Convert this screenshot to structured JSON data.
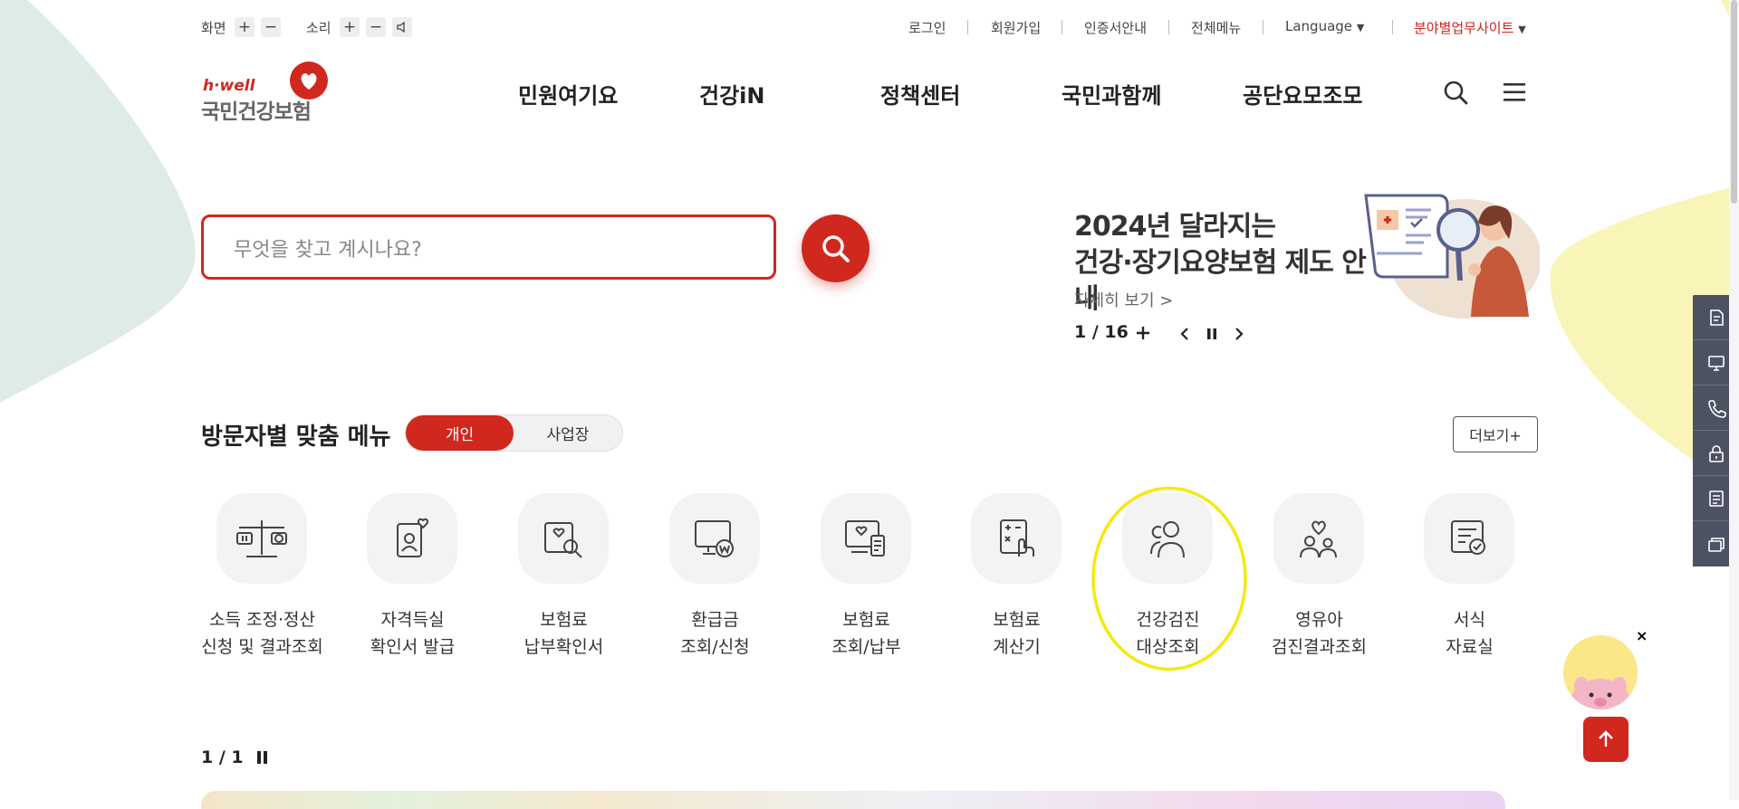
{
  "util": {
    "screen_label": "화면",
    "sound_label": "소리",
    "plus": "+",
    "minus": "−",
    "links": [
      "로그인",
      "회원가입",
      "인증서안내",
      "전체메뉴",
      "Language",
      "분야별업무사이트"
    ]
  },
  "logo": {
    "tagline": "h·well",
    "name": "국민건강보험"
  },
  "nav": [
    "민원여기요",
    "건강iN",
    "정책센터",
    "국민과함께",
    "공단요모조모"
  ],
  "search": {
    "placeholder": "무엇을 찾고 계시나요?"
  },
  "banner": {
    "title_line1": "2024년 달라지는",
    "title_line2": "건강·장기요양보험 제도 안내",
    "more": "자세히 보기 >",
    "page_current": "1",
    "page_total": "16"
  },
  "personal_menu": {
    "title": "방문자별 맞춤 메뉴",
    "tabs": [
      "개인",
      "사업장"
    ],
    "more": "더보기+",
    "items": [
      {
        "line1": "소득 조정·정산",
        "line2": "신청 및 결과조회",
        "icon": "scale-icon"
      },
      {
        "line1": "자격득실",
        "line2": "확인서 발급",
        "icon": "id-card-heart-icon"
      },
      {
        "line1": "보험료",
        "line2": "납부확인서",
        "icon": "document-search-icon"
      },
      {
        "line1": "환급금",
        "line2": "조회/신청",
        "icon": "monitor-won-icon"
      },
      {
        "line1": "보험료",
        "line2": "조회/납부",
        "icon": "monitor-receipt-icon"
      },
      {
        "line1": "보험료",
        "line2": "계산기",
        "icon": "calculator-hand-icon"
      },
      {
        "line1": "건강검진",
        "line2": "대상조회",
        "icon": "people-icon"
      },
      {
        "line1": "영유아",
        "line2": "검진결과조회",
        "icon": "family-heart-icon"
      },
      {
        "line1": "서식",
        "line2": "자료실",
        "icon": "form-check-icon"
      }
    ],
    "page_current": "1",
    "page_total": "1"
  },
  "colors": {
    "brand": "#d0281e",
    "highlight": "#f5e90e",
    "side_bar": "#4d5263"
  }
}
